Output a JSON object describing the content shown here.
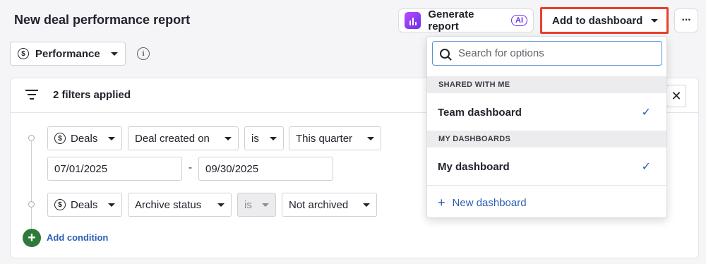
{
  "header": {
    "title": "New deal performance report",
    "generate_label": "Generate report",
    "ai_badge": "AI",
    "add_to_dashboard_label": "Add to dashboard",
    "more_label": "···"
  },
  "view_select": {
    "label": "Performance",
    "icon": "dollar-circle-icon"
  },
  "filters": {
    "summary": "2 filters applied",
    "conditions": [
      {
        "entity": "Deals",
        "field": "Deal created on",
        "operator": "is",
        "value": "This quarter",
        "date_from": "07/01/2025",
        "date_to": "09/30/2025"
      },
      {
        "entity": "Deals",
        "field": "Archive status",
        "operator": "is",
        "value": "Not archived"
      }
    ],
    "range_separator": "-",
    "add_condition_label": "Add condition"
  },
  "dropdown": {
    "search_placeholder": "Search for options",
    "sections": [
      {
        "header": "SHARED WITH ME",
        "items": [
          {
            "label": "Team dashboard",
            "checked": "✓"
          }
        ]
      },
      {
        "header": "MY DASHBOARDS",
        "items": [
          {
            "label": "My dashboard",
            "checked": "✓"
          }
        ]
      }
    ],
    "new_dashboard_label": "New dashboard"
  },
  "colors": {
    "accent_red": "#e8402b",
    "link_blue": "#2a5fb4",
    "add_green": "#2e7a3a",
    "ai_purple": "#6a2ee8"
  }
}
